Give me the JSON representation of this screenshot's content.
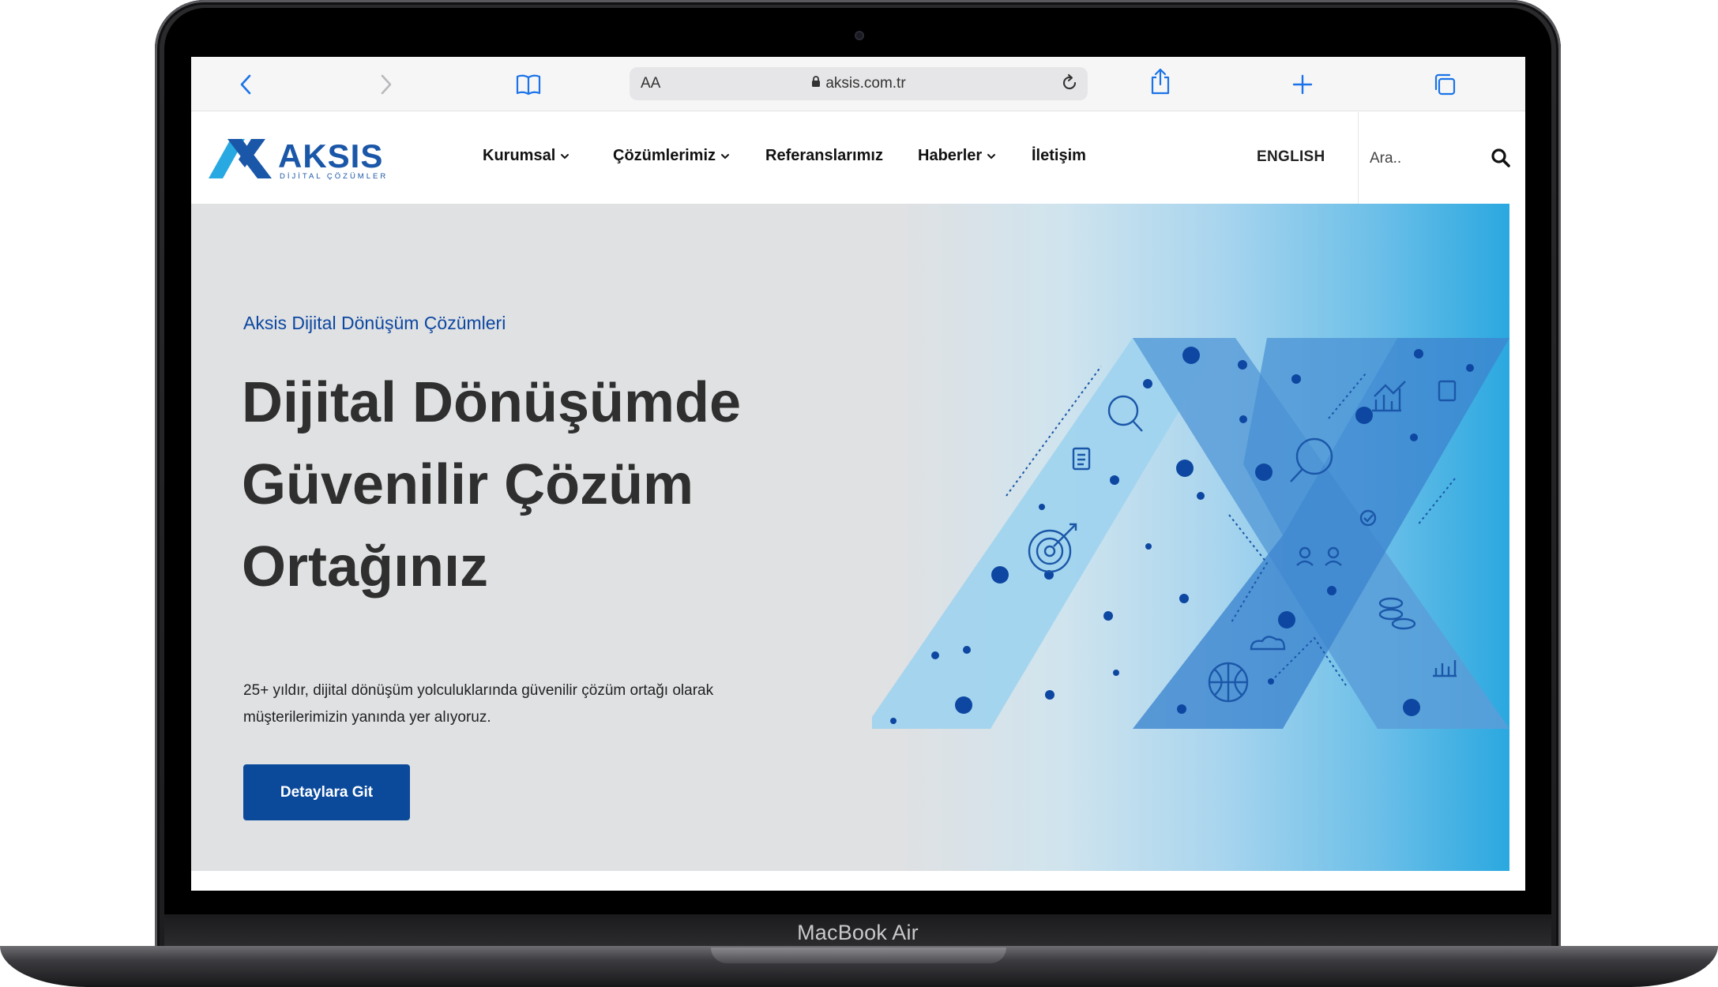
{
  "device": {
    "label": "MacBook Air"
  },
  "browser": {
    "text_size_label": "AA",
    "url": "aksis.com.tr",
    "icons": [
      "back-icon",
      "forward-icon",
      "bookmarks-icon",
      "lock-icon",
      "reload-icon",
      "share-icon",
      "new-tab-icon",
      "tabs-icon"
    ]
  },
  "site": {
    "logo": {
      "name": "AKSIS",
      "subtitle": "DİJİTAL ÇÖZÜMLER"
    },
    "nav": [
      {
        "label": "Kurumsal",
        "dropdown": true
      },
      {
        "label": "Çözümlerimiz",
        "dropdown": true
      },
      {
        "label": "Referanslarımız",
        "dropdown": false
      },
      {
        "label": "Haberler",
        "dropdown": true
      },
      {
        "label": "İletişim",
        "dropdown": false
      }
    ],
    "language_link": "ENGLISH",
    "search": {
      "placeholder": "Ara..",
      "value": ""
    }
  },
  "hero": {
    "eyebrow": "Aksis Dijital Dönüşüm Çözümleri",
    "headline": [
      "Dijital Dönüşümde",
      "Güvenilir Çözüm",
      "Ortağınız"
    ],
    "description": "25+ yıldır, dijital dönüşüm yolculuklarında güvenilir çözüm ortağı olarak müşterilerimizin yanında yer alıyoruz.",
    "cta_label": "Detaylara Git"
  },
  "colors": {
    "brand": "#1b57a8",
    "button": "#0b4a9b",
    "eyebrow": "#0d47a1",
    "hero_bg": "#dfe1e3",
    "accent_light": "#2aa8e0"
  }
}
